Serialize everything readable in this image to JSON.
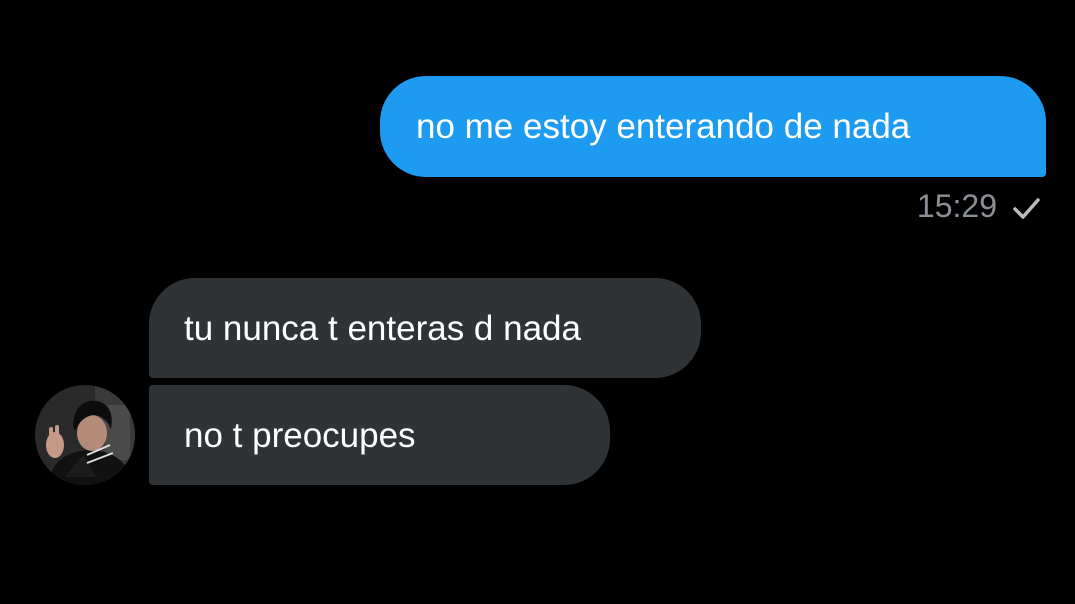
{
  "conversation": {
    "sent_messages": [
      {
        "text": "no me estoy enterando de nada",
        "time": "15:29",
        "status_icon": "check-icon"
      }
    ],
    "received_messages": [
      {
        "text": "tu nunca t enteras d nada"
      },
      {
        "text": "no t preocupes"
      }
    ],
    "contact_avatar_icon": "avatar-photo"
  },
  "colors": {
    "background": "#000000",
    "sent_bubble": "#1d9bf0",
    "received_bubble": "#2f3336",
    "message_text": "#ffffff",
    "timestamp": "#8b9096"
  }
}
